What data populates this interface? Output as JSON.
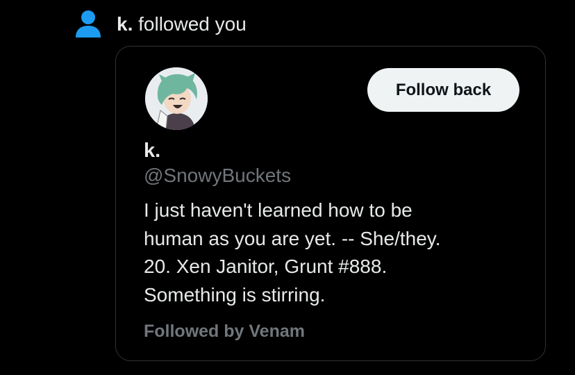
{
  "notification": {
    "user_name": "k.",
    "action_text": " followed you"
  },
  "card": {
    "follow_button_label": "Follow back",
    "display_name": "k.",
    "handle": "@SnowyBuckets",
    "bio_lines": [
      "I just haven't learned how to be",
      "human as you are yet. -- She/they.",
      "20. Xen Janitor, Grunt #888.",
      "Something is stirring."
    ],
    "followed_by": "Followed by Venam"
  },
  "colors": {
    "background": "#000000",
    "accent_icon": "#1d9bf0",
    "primary_text": "#e7e9ea",
    "secondary_text": "#71767b",
    "button_bg": "#eff3f4",
    "card_border": "#2f3336"
  },
  "icons": {
    "header": "person-icon"
  }
}
